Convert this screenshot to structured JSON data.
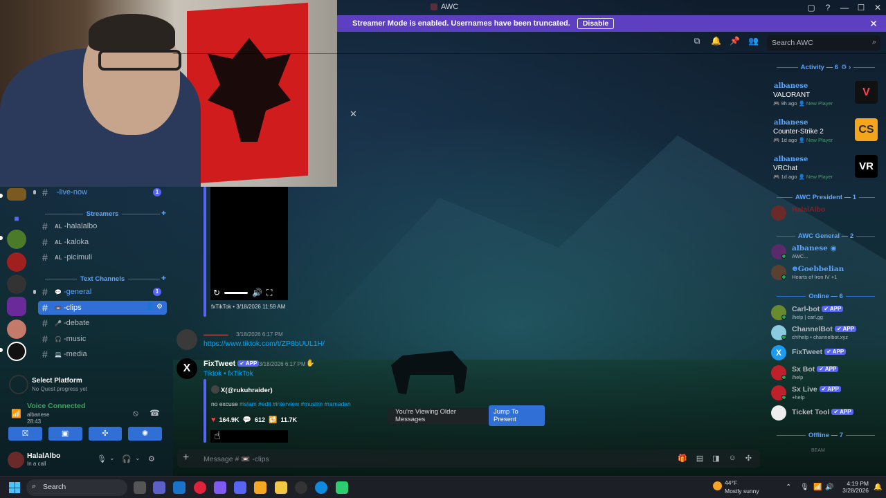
{
  "window": {
    "title": "AWC",
    "controls": [
      "▢",
      "?",
      "—",
      "☐",
      "✕"
    ]
  },
  "banner": {
    "text": "Streamer Mode is enabled. Usernames have been truncated.",
    "button": "Disable",
    "close": "✕"
  },
  "search": {
    "placeholder": "Search AWC"
  },
  "webcam": {
    "close": "✕"
  },
  "sidebar": {
    "categories": {
      "streamers": "Streamers",
      "text_channels": "Text Channels"
    },
    "channels": [
      {
        "prefix": "",
        "name": "-live-now",
        "badge": "1"
      },
      {
        "prefix": "AL",
        "name": "-halalalbo"
      },
      {
        "prefix": "AL",
        "name": "-kaloka"
      },
      {
        "prefix": "AL",
        "name": "-picimuli"
      },
      {
        "prefix": "💬",
        "name": "-general",
        "badge": "1"
      },
      {
        "prefix": "📼",
        "name": "-clips"
      },
      {
        "prefix": "🎤",
        "name": "-debate"
      },
      {
        "prefix": "🎧",
        "name": "-music"
      },
      {
        "prefix": "💻",
        "name": "-media"
      }
    ],
    "quest": {
      "title": "Select Platform",
      "sub": "No Quest progress yet"
    },
    "voice": {
      "status": "Voice Connected",
      "channel": "albanese",
      "timer": "28:43"
    },
    "user": {
      "name": "HalalAlbo",
      "status": "In a call"
    }
  },
  "messages": {
    "video_footer": "fxTikTok • 3/18/2026 11:59 AM",
    "msg1": {
      "time": "3/18/2026 6:17 PM",
      "link": "https://www.tiktok.com/t/ZP8bUUL1H/"
    },
    "msg2": {
      "author": "FixTweet",
      "app_tag": "✔ APP",
      "time": "3/18/2026 6:17 PM",
      "source": "Tiktok • fxTikTok",
      "embed_author": "@rukuhraider)",
      "text_plain": "no excuse",
      "tags": "#islam #edit #interview #muslim #ramadan",
      "likes": "164.9K",
      "comments": "612",
      "retweets": "11.7K"
    },
    "older_notice": "You're Viewing Older Messages",
    "jump": "Jump To Present",
    "composer_placeholder": "Message # 📼 -clips"
  },
  "members": {
    "activity_header": "Activity — 6",
    "activities": [
      {
        "user": "albanese",
        "game": "VALORANT",
        "ago": "9h ago",
        "tag": "New Player",
        "color": "#fd4556"
      },
      {
        "user": "albanese",
        "game": "Counter-Strike 2",
        "ago": "1d ago",
        "tag": "New Player",
        "color": "#f4a51c"
      },
      {
        "user": "albanese",
        "game": "VRChat",
        "ago": "1d ago",
        "tag": "New Player",
        "color": "#ffffff"
      }
    ],
    "president_header": "AWC President — 1",
    "president": {
      "name": "HalalAlbo"
    },
    "general_header": "AWC General — 2",
    "general": [
      {
        "name": "albanese ◉",
        "sub": "AWC..."
      },
      {
        "name": "⊕Goebbelian",
        "sub": "Hearts of Iron IV +1"
      }
    ],
    "online_header": "Online — 6",
    "online": [
      {
        "name": "Carl-bot",
        "sub": "/help | carl.gg"
      },
      {
        "name": "ChannelBot",
        "sub": "ch!help • channelbot.xyz"
      },
      {
        "name": "FixTweet",
        "sub": ""
      },
      {
        "name": "Sx Bot",
        "sub": "/help"
      },
      {
        "name": "Sx Live",
        "sub": "+help"
      },
      {
        "name": "Ticket Tool",
        "sub": ""
      }
    ],
    "offline_header": "Offline — 7",
    "offline_peek": "BEAM"
  },
  "taskbar": {
    "search": "Search",
    "weather_temp": "44°F",
    "weather_desc": "Mostly sunny",
    "time": "4:19 PM",
    "date": "3/28/2026"
  }
}
